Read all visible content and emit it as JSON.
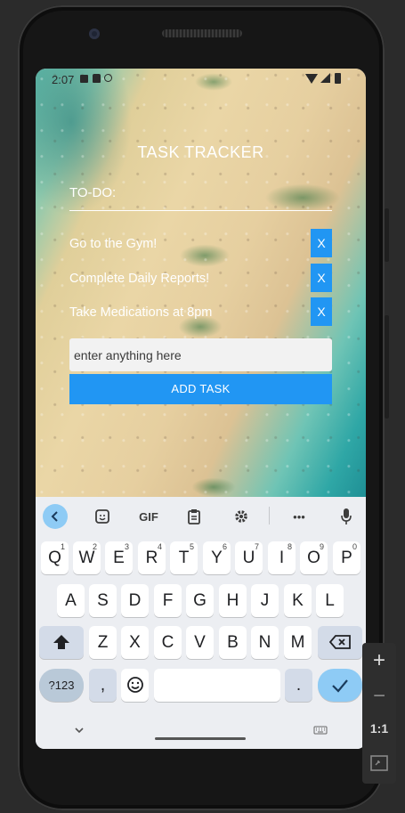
{
  "status_bar": {
    "time": "2:07"
  },
  "app": {
    "title": "TASK TRACKER",
    "todo_label": "TO-DO:",
    "tasks": [
      {
        "text": "Go to the Gym!",
        "delete_label": "X"
      },
      {
        "text": "Complete Daily Reports!",
        "delete_label": "X"
      },
      {
        "text": "Take Medications at 8pm",
        "delete_label": "X"
      }
    ],
    "input": {
      "placeholder": "enter anything here",
      "value": ""
    },
    "add_button": "ADD TASK"
  },
  "keyboard": {
    "toolbar": {
      "gif_label": "GIF",
      "more_label": "•••"
    },
    "row1": [
      {
        "key": "Q",
        "hint": "1"
      },
      {
        "key": "W",
        "hint": "2"
      },
      {
        "key": "E",
        "hint": "3"
      },
      {
        "key": "R",
        "hint": "4"
      },
      {
        "key": "T",
        "hint": "5"
      },
      {
        "key": "Y",
        "hint": "6"
      },
      {
        "key": "U",
        "hint": "7"
      },
      {
        "key": "I",
        "hint": "8"
      },
      {
        "key": "O",
        "hint": "9"
      },
      {
        "key": "P",
        "hint": "0"
      }
    ],
    "row2": [
      "A",
      "S",
      "D",
      "F",
      "G",
      "H",
      "J",
      "K",
      "L"
    ],
    "row3": [
      "Z",
      "X",
      "C",
      "V",
      "B",
      "N",
      "M"
    ],
    "symbols_label": "?123",
    "comma_label": ",",
    "period_label": "."
  },
  "emulator_controls": {
    "zoom_in": "+",
    "zoom_out": "−",
    "one_to_one": "1:1"
  },
  "colors": {
    "accent": "#2196f3",
    "keyboard_bg": "#eceef2",
    "enter_key": "#8ecbf5"
  }
}
